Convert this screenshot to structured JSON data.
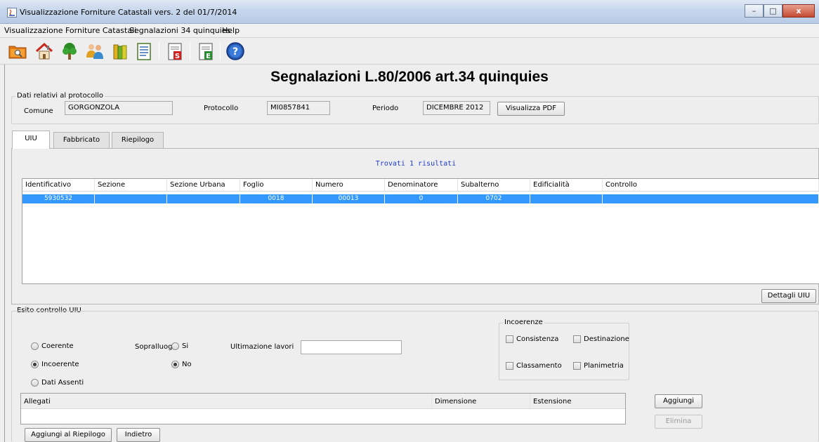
{
  "window": {
    "title": "Visualizzazione Forniture Catastali vers. 2 del 01/7/2014",
    "controls": {
      "minimize": "–",
      "maximize": "□",
      "close": "x"
    }
  },
  "menu": [
    "Visualizzazione Forniture Catastali",
    "Segnalazioni 34 quinquies",
    "Help"
  ],
  "toolbar": {
    "icons": [
      "folder-search-icon",
      "house-icon",
      "tree-icon",
      "people-icon",
      "books-icon",
      "document-list-icon",
      "document-s-icon",
      "document-e-icon",
      "help-icon"
    ]
  },
  "page_title": "Segnalazioni L.80/2006 art.34 quinquies",
  "protocol": {
    "group_label": "Dati relativi al protocollo",
    "comune_label": "Comune",
    "comune_value": "GORGONZOLA",
    "protocollo_label": "Protocollo",
    "protocollo_value": "MI0857841",
    "periodo_label": "Periodo",
    "periodo_value": "DICEMBRE 2012",
    "pdf_button": "Visualizza PDF"
  },
  "tabs": [
    "UIU",
    "Fabbricato",
    "Riepilogo"
  ],
  "results_text": "Trovati 1 risultati",
  "uiu_table": {
    "columns": [
      "Identificativo",
      "Sezione",
      "Sezione Urbana",
      "Foglio",
      "Numero",
      "Denominatore",
      "Subalterno",
      "Edificialità",
      "Controllo"
    ],
    "rows": [
      [
        "5930532",
        "",
        "",
        "0018",
        "00013",
        "0",
        "0702",
        "",
        ""
      ]
    ]
  },
  "dettagli_button": "Dettagli UIU",
  "esito": {
    "group_label": "Esito controllo UIU",
    "radios": {
      "coerente": "Coerente",
      "incoerente": "Incoerente",
      "dati_assenti": "Dati Assenti",
      "selected": "Incoerente"
    },
    "sopralluogo_label": "Sopralluogo",
    "sopralluogo_si": "Si",
    "sopralluogo_no": "No",
    "sopralluogo_selected": "No",
    "ultimazione_label": "Ultimazione lavori",
    "ultimazione_value": "",
    "incoerenze": {
      "label": "Incoerenze",
      "consistenza": "Consistenza",
      "destinazione": "Destinazione",
      "classamento": "Classamento",
      "planimetria": "Planimetria"
    }
  },
  "allegati_table": {
    "columns": [
      "Allegati",
      "Dimensione",
      "Estensione"
    ],
    "rows": []
  },
  "buttons": {
    "aggiungi": "Aggiungi",
    "elimina": "Elimina",
    "aggiungi_riepilogo": "Aggiungi al Riepilogo",
    "indietro": "Indietro"
  }
}
